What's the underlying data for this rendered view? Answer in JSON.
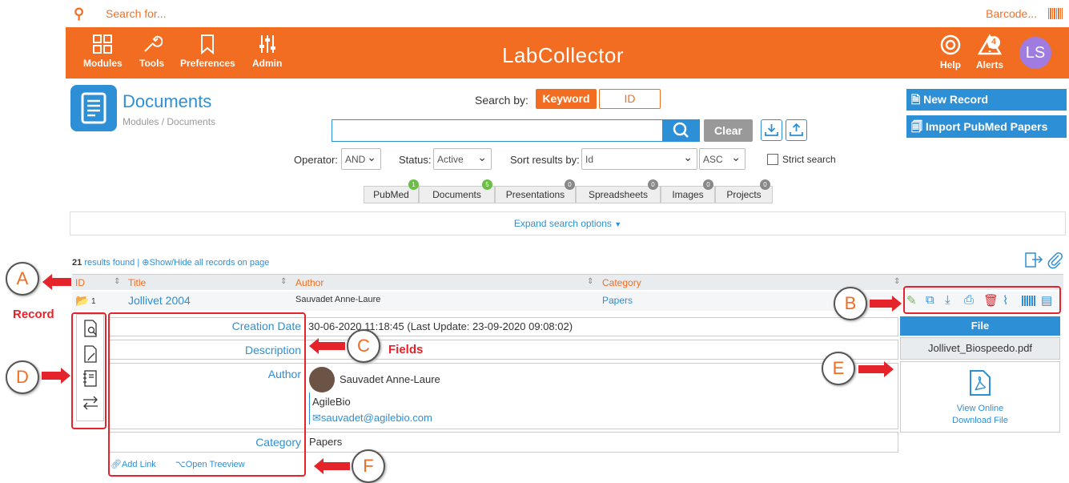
{
  "search": {
    "placeholder": "Search for...",
    "barcode_label": "Barcode..."
  },
  "nav": {
    "modules": "Modules",
    "tools": "Tools",
    "preferences": "Preferences",
    "admin": "Admin",
    "logo": "LabCollector",
    "help": "Help",
    "alerts": "Alerts",
    "alerts_count": "4",
    "avatar": "LS"
  },
  "module": {
    "title": "Documents",
    "breadcrumb": "Modules / Documents"
  },
  "searchby": {
    "label": "Search by:",
    "keyword": "Keyword",
    "id": "ID",
    "clear": "Clear"
  },
  "actions": {
    "new_record": "New Record",
    "import_pubmed": "Import PubMed Papers"
  },
  "filters": {
    "operator_label": "Operator:",
    "operator_value": "AND",
    "status_label": "Status:",
    "status_value": "Active",
    "sort_label": "Sort results by:",
    "sort_value": "Id",
    "order_value": "ASC",
    "strict": "Strict search"
  },
  "tabs": [
    {
      "label": "PubMed",
      "count": "1"
    },
    {
      "label": "Documents",
      "count": "5"
    },
    {
      "label": "Presentations",
      "count": "0"
    },
    {
      "label": "Spreadsheets",
      "count": "0"
    },
    {
      "label": "Images",
      "count": "0"
    },
    {
      "label": "Projects",
      "count": "0"
    }
  ],
  "expand": "Expand search options",
  "results": {
    "count": "21",
    "text": "results found |",
    "toggle": "Show/Hide all records on page"
  },
  "table": {
    "headers": [
      "ID",
      "Title",
      "Author",
      "Category"
    ],
    "row": {
      "id": "1",
      "title": "Jollivet 2004",
      "author": "Sauvadet Anne-Laure",
      "category": "Papers"
    }
  },
  "fields": {
    "creation_label": "Creation Date",
    "creation_value": "30-06-2020 11:18:45 (Last Update: 23-09-2020 09:08:02)",
    "description_label": "Description",
    "author_label": "Author",
    "author_name": "Sauvadet Anne-Laure",
    "author_org": "AgileBio",
    "author_email": "sauvadet@agilebio.com",
    "category_label": "Category",
    "category_value": "Papers",
    "add_link": "Add Link",
    "open_treeview": "Open Treeview"
  },
  "file": {
    "header": "File",
    "name": "Jollivet_Biospeedo.pdf",
    "view": "View Online",
    "download": "Download File"
  },
  "annotations": {
    "a": "A",
    "b": "B",
    "c": "C",
    "d": "D",
    "e": "E",
    "f": "F",
    "record": "Record",
    "fields": "Fields"
  },
  "colors": {
    "orange": "#f26d21",
    "blue": "#2d8fd5",
    "red": "#e4232a",
    "gray": "#999999"
  }
}
